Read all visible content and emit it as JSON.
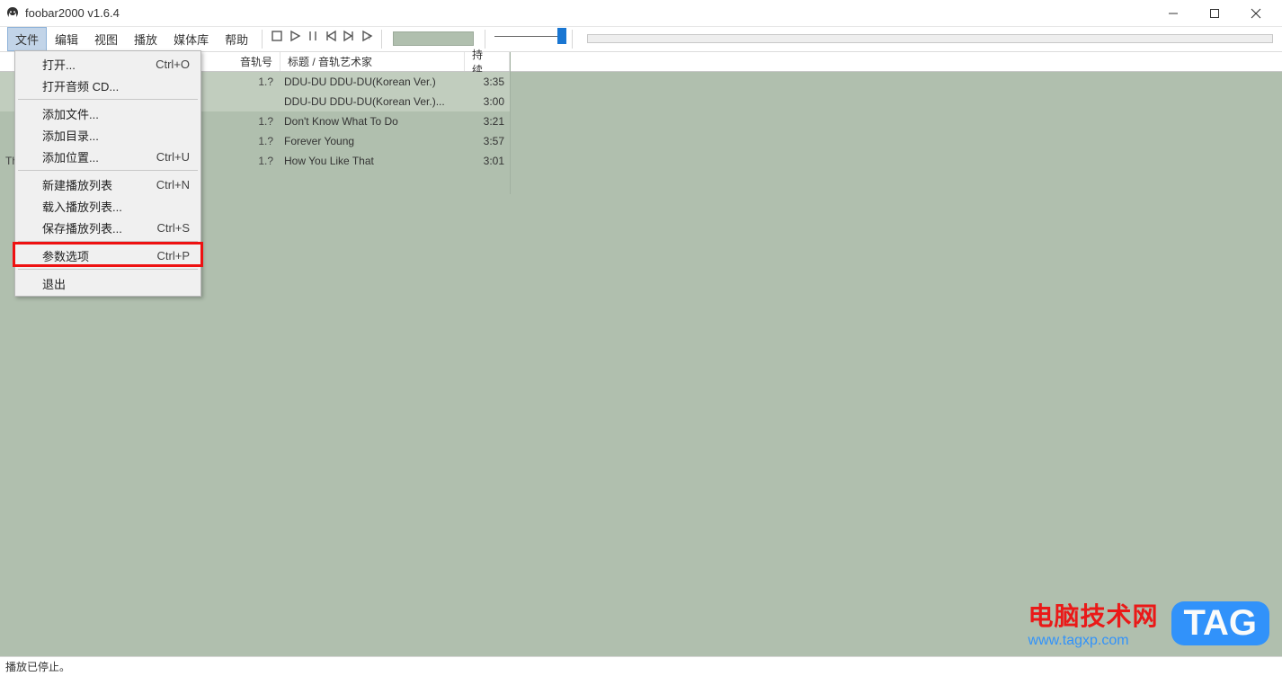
{
  "window": {
    "title": "foobar2000 v1.6.4"
  },
  "menu": {
    "items": [
      "文件",
      "编辑",
      "视图",
      "播放",
      "媒体库",
      "帮助"
    ],
    "active_index": 0
  },
  "file_menu": {
    "open": "打开...",
    "open_sc": "Ctrl+O",
    "open_audio_cd": "打开音频 CD...",
    "add_files": "添加文件...",
    "add_folder": "添加目录...",
    "add_location": "添加位置...",
    "add_location_sc": "Ctrl+U",
    "new_playlist": "新建播放列表",
    "new_playlist_sc": "Ctrl+N",
    "load_playlist": "载入播放列表...",
    "save_playlist": "保存播放列表...",
    "save_playlist_sc": "Ctrl+S",
    "preferences": "参数选项",
    "preferences_sc": "Ctrl+P",
    "exit": "退出"
  },
  "columns": {
    "trackno": "音轨号",
    "title": "标题 / 音轨艺术家",
    "duration": "持续..."
  },
  "rows_prefix_visible": {
    "4": "That"
  },
  "tracks": [
    {
      "no": "1.?",
      "title": "DDU-DU DDU-DU(Korean Ver.)",
      "dur": "3:35",
      "selected": true
    },
    {
      "no": "",
      "title": "DDU-DU DDU-DU(Korean Ver.)...",
      "dur": "3:00",
      "selected": true
    },
    {
      "no": "1.?",
      "title": "Don't Know What To Do",
      "dur": "3:21",
      "selected": false
    },
    {
      "no": "1.?",
      "title": "Forever Young",
      "dur": "3:57",
      "selected": false
    },
    {
      "no": "1.?",
      "title": "How You Like That",
      "dur": "3:01",
      "selected": false
    }
  ],
  "status": "播放已停止。",
  "watermark": {
    "line1": "电脑技术网",
    "line2": "www.tagxp.com",
    "tag": "TAG"
  }
}
